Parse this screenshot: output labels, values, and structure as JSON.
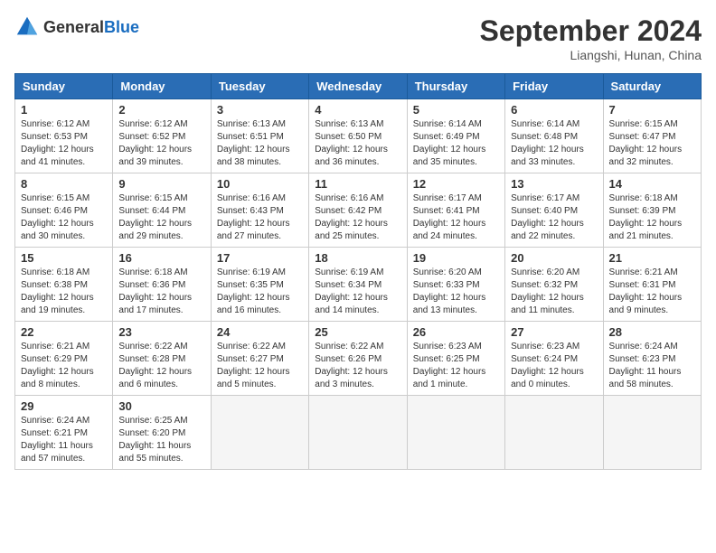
{
  "header": {
    "logo_general": "General",
    "logo_blue": "Blue",
    "month": "September 2024",
    "location": "Liangshi, Hunan, China"
  },
  "days_of_week": [
    "Sunday",
    "Monday",
    "Tuesday",
    "Wednesday",
    "Thursday",
    "Friday",
    "Saturday"
  ],
  "weeks": [
    [
      {
        "num": "1",
        "info": "Sunrise: 6:12 AM\nSunset: 6:53 PM\nDaylight: 12 hours\nand 41 minutes."
      },
      {
        "num": "2",
        "info": "Sunrise: 6:12 AM\nSunset: 6:52 PM\nDaylight: 12 hours\nand 39 minutes."
      },
      {
        "num": "3",
        "info": "Sunrise: 6:13 AM\nSunset: 6:51 PM\nDaylight: 12 hours\nand 38 minutes."
      },
      {
        "num": "4",
        "info": "Sunrise: 6:13 AM\nSunset: 6:50 PM\nDaylight: 12 hours\nand 36 minutes."
      },
      {
        "num": "5",
        "info": "Sunrise: 6:14 AM\nSunset: 6:49 PM\nDaylight: 12 hours\nand 35 minutes."
      },
      {
        "num": "6",
        "info": "Sunrise: 6:14 AM\nSunset: 6:48 PM\nDaylight: 12 hours\nand 33 minutes."
      },
      {
        "num": "7",
        "info": "Sunrise: 6:15 AM\nSunset: 6:47 PM\nDaylight: 12 hours\nand 32 minutes."
      }
    ],
    [
      {
        "num": "8",
        "info": "Sunrise: 6:15 AM\nSunset: 6:46 PM\nDaylight: 12 hours\nand 30 minutes."
      },
      {
        "num": "9",
        "info": "Sunrise: 6:15 AM\nSunset: 6:44 PM\nDaylight: 12 hours\nand 29 minutes."
      },
      {
        "num": "10",
        "info": "Sunrise: 6:16 AM\nSunset: 6:43 PM\nDaylight: 12 hours\nand 27 minutes."
      },
      {
        "num": "11",
        "info": "Sunrise: 6:16 AM\nSunset: 6:42 PM\nDaylight: 12 hours\nand 25 minutes."
      },
      {
        "num": "12",
        "info": "Sunrise: 6:17 AM\nSunset: 6:41 PM\nDaylight: 12 hours\nand 24 minutes."
      },
      {
        "num": "13",
        "info": "Sunrise: 6:17 AM\nSunset: 6:40 PM\nDaylight: 12 hours\nand 22 minutes."
      },
      {
        "num": "14",
        "info": "Sunrise: 6:18 AM\nSunset: 6:39 PM\nDaylight: 12 hours\nand 21 minutes."
      }
    ],
    [
      {
        "num": "15",
        "info": "Sunrise: 6:18 AM\nSunset: 6:38 PM\nDaylight: 12 hours\nand 19 minutes."
      },
      {
        "num": "16",
        "info": "Sunrise: 6:18 AM\nSunset: 6:36 PM\nDaylight: 12 hours\nand 17 minutes."
      },
      {
        "num": "17",
        "info": "Sunrise: 6:19 AM\nSunset: 6:35 PM\nDaylight: 12 hours\nand 16 minutes."
      },
      {
        "num": "18",
        "info": "Sunrise: 6:19 AM\nSunset: 6:34 PM\nDaylight: 12 hours\nand 14 minutes."
      },
      {
        "num": "19",
        "info": "Sunrise: 6:20 AM\nSunset: 6:33 PM\nDaylight: 12 hours\nand 13 minutes."
      },
      {
        "num": "20",
        "info": "Sunrise: 6:20 AM\nSunset: 6:32 PM\nDaylight: 12 hours\nand 11 minutes."
      },
      {
        "num": "21",
        "info": "Sunrise: 6:21 AM\nSunset: 6:31 PM\nDaylight: 12 hours\nand 9 minutes."
      }
    ],
    [
      {
        "num": "22",
        "info": "Sunrise: 6:21 AM\nSunset: 6:29 PM\nDaylight: 12 hours\nand 8 minutes."
      },
      {
        "num": "23",
        "info": "Sunrise: 6:22 AM\nSunset: 6:28 PM\nDaylight: 12 hours\nand 6 minutes."
      },
      {
        "num": "24",
        "info": "Sunrise: 6:22 AM\nSunset: 6:27 PM\nDaylight: 12 hours\nand 5 minutes."
      },
      {
        "num": "25",
        "info": "Sunrise: 6:22 AM\nSunset: 6:26 PM\nDaylight: 12 hours\nand 3 minutes."
      },
      {
        "num": "26",
        "info": "Sunrise: 6:23 AM\nSunset: 6:25 PM\nDaylight: 12 hours\nand 1 minute."
      },
      {
        "num": "27",
        "info": "Sunrise: 6:23 AM\nSunset: 6:24 PM\nDaylight: 12 hours\nand 0 minutes."
      },
      {
        "num": "28",
        "info": "Sunrise: 6:24 AM\nSunset: 6:23 PM\nDaylight: 11 hours\nand 58 minutes."
      }
    ],
    [
      {
        "num": "29",
        "info": "Sunrise: 6:24 AM\nSunset: 6:21 PM\nDaylight: 11 hours\nand 57 minutes."
      },
      {
        "num": "30",
        "info": "Sunrise: 6:25 AM\nSunset: 6:20 PM\nDaylight: 11 hours\nand 55 minutes."
      },
      {
        "num": "",
        "info": ""
      },
      {
        "num": "",
        "info": ""
      },
      {
        "num": "",
        "info": ""
      },
      {
        "num": "",
        "info": ""
      },
      {
        "num": "",
        "info": ""
      }
    ]
  ]
}
